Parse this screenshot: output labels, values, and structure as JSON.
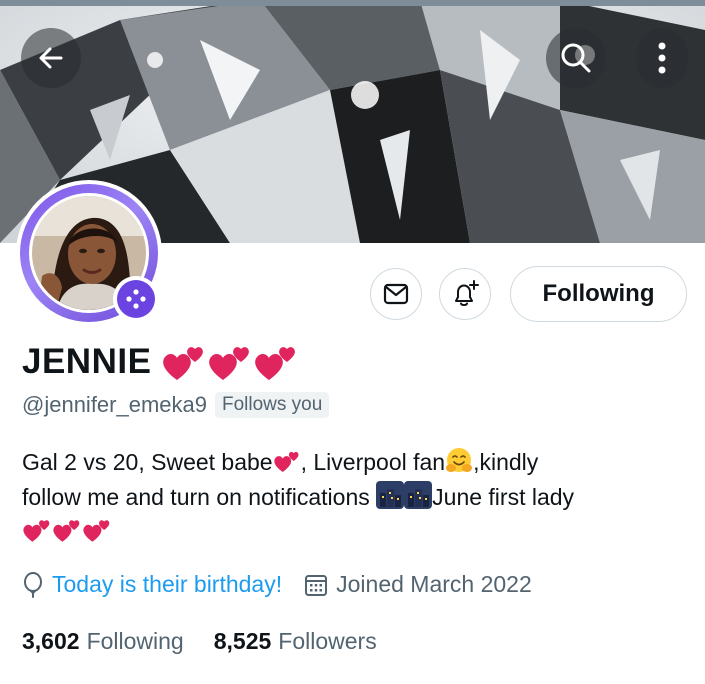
{
  "header": {
    "back_icon": "arrow-left-icon",
    "search_icon": "search-icon",
    "more_icon": "more-vertical-icon"
  },
  "profile": {
    "name": "JENNIE",
    "handle": "@jennifer_emeka9",
    "follows_you": "Follows you",
    "following_button": "Following",
    "bio": {
      "line1_a": "Gal 2 vs 20, Sweet babe",
      "line1_b": ", Liverpool fan",
      "line1_c": ",kindly",
      "line2_a": "follow me and turn on notifications ",
      "line2_b": "June first lady"
    },
    "birthday": "Today is their birthday!",
    "joined": "Joined March 2022",
    "stats": {
      "following_count": "3,602",
      "following_label": "Following",
      "followers_count": "8,525",
      "followers_label": "Followers"
    }
  },
  "colors": {
    "accent": "#1d9bf0",
    "secondary_text": "#536471",
    "avatar_ring": "#7b55e8",
    "heart": "#e0245e"
  }
}
